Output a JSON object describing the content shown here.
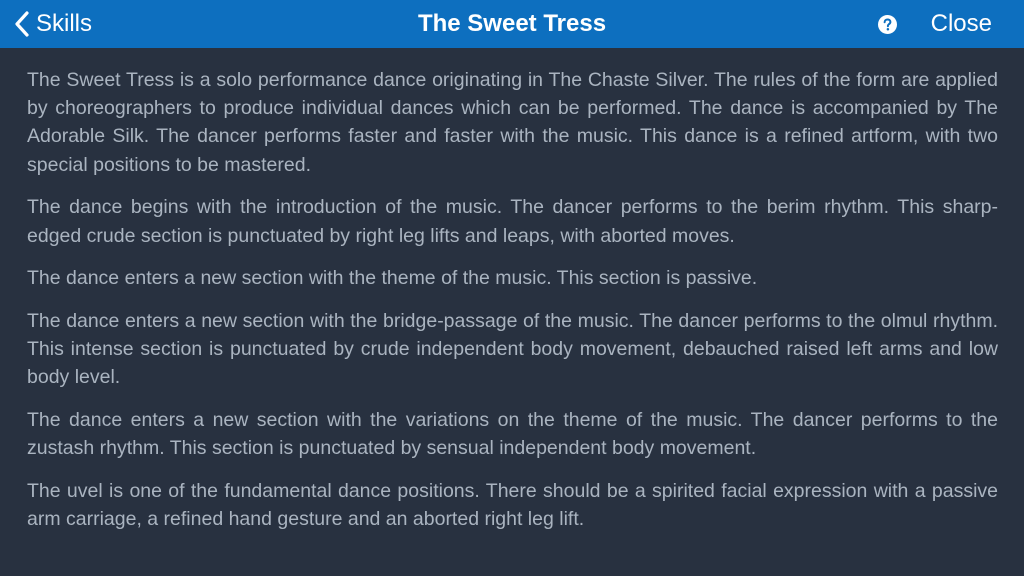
{
  "colors": {
    "navbar_background": "#0d6fbf",
    "page_background": "#283140",
    "body_text": "#aab4c0",
    "navbar_text": "#ffffff"
  },
  "navbar": {
    "back_icon": "chevron-left-icon",
    "back_label": "Skills",
    "title": "The Sweet Tress",
    "help_icon": "question-circle-icon",
    "close_label": "Close"
  },
  "content": {
    "paragraphs": [
      "The Sweet Tress is a solo performance dance originating in The Chaste Silver. The rules of the form are applied by choreographers to produce individual dances which can be performed. The dance is accompanied by The Adorable Silk. The dancer performs faster and faster with the music. This dance is a refined artform, with two special positions to be mastered.",
      "The dance begins with the introduction of the music. The dancer performs to the berim rhythm. This sharp-edged crude section is punctuated by right leg lifts and leaps, with aborted moves.",
      "The dance enters a new section with the theme of the music. This section is passive.",
      "The dance enters a new section with the bridge-passage of the music. The dancer performs to the olmul rhythm. This intense section is punctuated by crude independent body movement, debauched raised left arms and low body level.",
      "The dance enters a new section with the variations on the theme of the music. The dancer performs to the zustash rhythm. This section is punctuated by sensual independent body movement.",
      "The uvel is one of the fundamental dance positions. There should be a spirited facial expression with a passive arm carriage, a refined hand gesture and an aborted right leg lift."
    ]
  }
}
